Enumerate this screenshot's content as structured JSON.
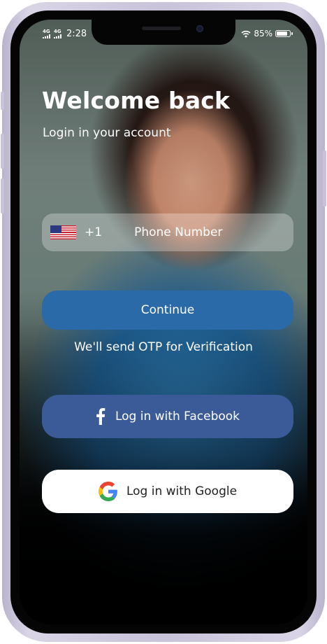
{
  "status_bar": {
    "network_1": "4G",
    "network_2": "4G",
    "time": "2:28",
    "battery": "85%",
    "battery_level": 0.85
  },
  "login": {
    "title": "Welcome back",
    "subtitle": "Login in your account",
    "country_flag": "us-flag-icon",
    "dial_code": "+1",
    "phone_placeholder": "Phone Number",
    "phone_value": "",
    "continue_label": "Continue",
    "otp_note": "We'll send OTP for Verification",
    "facebook_label": "Log in with Facebook",
    "google_label": "Log in with Google"
  },
  "colors": {
    "continue_button": "#2b6aa8",
    "facebook_button": "#3a5a98",
    "google_button": "#ffffff",
    "phone_frame": "#c8c2da"
  }
}
